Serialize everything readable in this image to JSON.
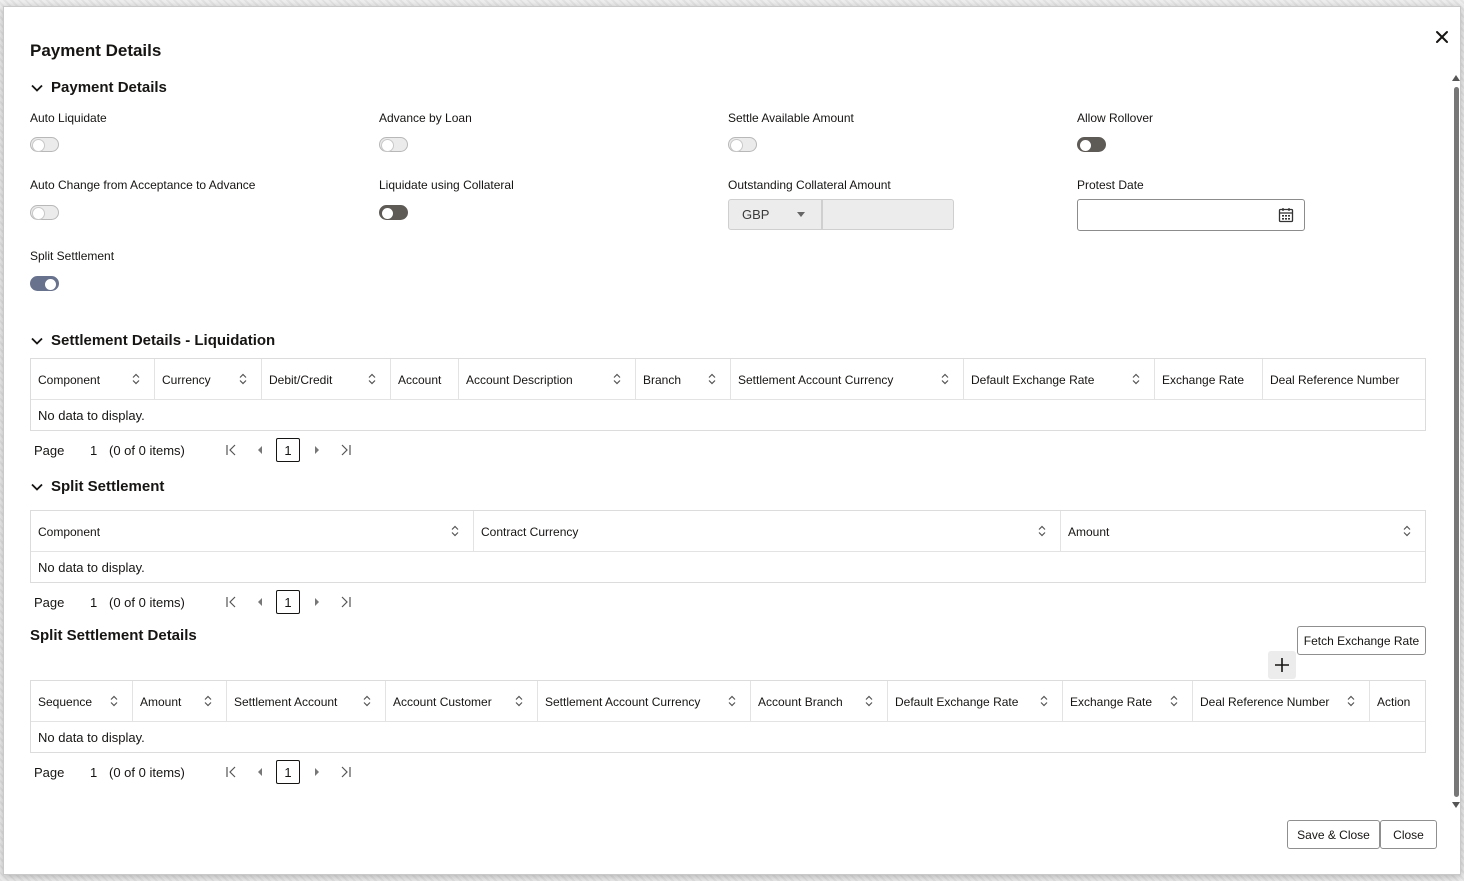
{
  "dialog": {
    "title": "Payment Details",
    "close_icon": "close-icon"
  },
  "payment_section": {
    "header": "Payment Details",
    "fields": {
      "auto_liquidate": {
        "label": "Auto Liquidate",
        "state": "off-disabled"
      },
      "advance_by_loan": {
        "label": "Advance by Loan",
        "state": "off-disabled"
      },
      "settle_available_amount": {
        "label": "Settle Available Amount",
        "state": "off-disabled"
      },
      "allow_rollover": {
        "label": "Allow Rollover",
        "state": "off-enabled"
      },
      "auto_change": {
        "label": "Auto Change from Acceptance to Advance",
        "state": "off-disabled"
      },
      "liquidate_collateral": {
        "label": "Liquidate using Collateral",
        "state": "off-enabled"
      },
      "outstanding_collateral": {
        "label": "Outstanding Collateral Amount",
        "currency": "GBP",
        "amount": ""
      },
      "protest_date": {
        "label": "Protest Date",
        "value": "",
        "icon": "calendar-icon"
      },
      "split_settlement": {
        "label": "Split Settlement",
        "state": "on"
      }
    }
  },
  "liquidation": {
    "header": "Settlement Details - Liquidation",
    "columns": [
      "Component",
      "Currency",
      "Debit/Credit",
      "Account",
      "Account Description",
      "Branch",
      "Settlement Account Currency",
      "Default Exchange Rate",
      "Exchange Rate",
      "Deal Reference Number"
    ],
    "empty_text": "No data to display.",
    "pager": {
      "label": "Page",
      "page": "1",
      "count": "(0 of 0 items)",
      "current": "1"
    }
  },
  "split": {
    "header": "Split Settlement",
    "columns": [
      "Component",
      "Contract Currency",
      "Amount"
    ],
    "empty_text": "No data to display.",
    "pager": {
      "label": "Page",
      "page": "1",
      "count": "(0 of 0 items)",
      "current": "1"
    }
  },
  "split_details": {
    "header": "Split Settlement Details",
    "fetch_button": "Fetch Exchange Rate",
    "add_icon": "plus-icon",
    "columns": [
      "Sequence",
      "Amount",
      "Settlement Account",
      "Account Customer",
      "Settlement Account Currency",
      "Account Branch",
      "Default Exchange Rate",
      "Exchange Rate",
      "Deal Reference Number",
      "Action"
    ],
    "empty_text": "No data to display.",
    "pager": {
      "label": "Page",
      "page": "1",
      "count": "(0 of 0 items)",
      "current": "1"
    }
  },
  "footer": {
    "save_close": "Save & Close",
    "close": "Close"
  }
}
